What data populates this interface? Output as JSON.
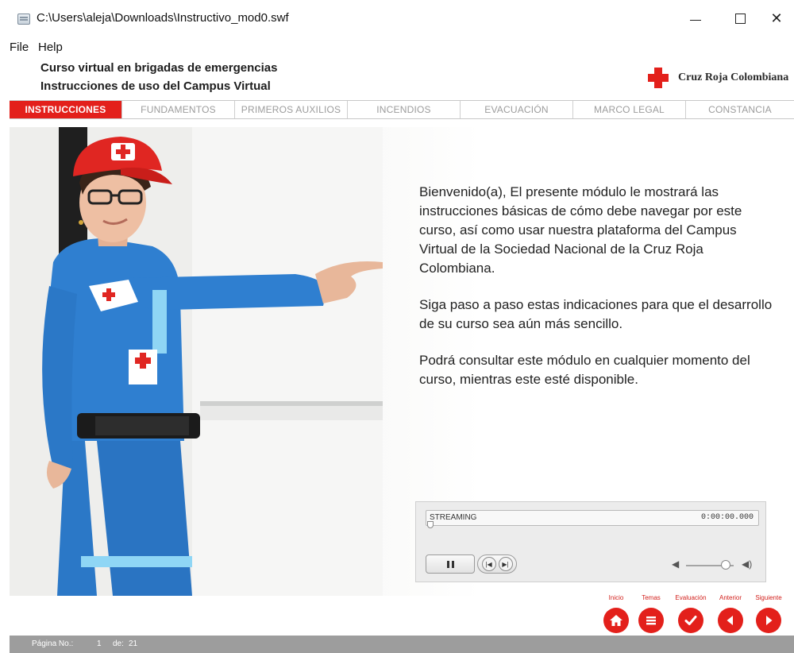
{
  "window": {
    "title": "C:\\Users\\aleja\\Downloads\\Instructivo_mod0.swf",
    "minimize_glyph": "—",
    "maximize_glyph": "☐",
    "close_glyph": "✕"
  },
  "menu": {
    "file": "File",
    "help": "Help"
  },
  "course": {
    "title": "Curso virtual en brigadas de emergencias",
    "subtitle": "Instrucciones de uso del Campus Virtual",
    "brand_name": "Cruz Roja Colombiana",
    "brand_color": "#e3201b"
  },
  "tabs": [
    {
      "label": "INSTRUCCIONES",
      "active": true
    },
    {
      "label": "FUNDAMENTOS",
      "active": false
    },
    {
      "label": "PRIMEROS AUXILIOS",
      "active": false
    },
    {
      "label": "INCENDIOS",
      "active": false
    },
    {
      "label": "EVACUACIÓN",
      "active": false
    },
    {
      "label": "MARCO LEGAL",
      "active": false
    },
    {
      "label": "CONSTANCIA",
      "active": false
    }
  ],
  "content": {
    "paragraphs": [
      "Bienvenido(a), El presente módulo le mostrará las instrucciones básicas de cómo debe navegar por este curso, así como usar nuestra plataforma del Campus Virtual de la Sociedad Nacional de la Cruz Roja Colombiana.",
      "Siga paso a paso estas indicaciones para que el desarrollo de su curso sea aún más sencillo.",
      "Podrá consultar este módulo en cualquier momento del curso, mientras este esté disponible."
    ]
  },
  "player": {
    "stream_label": "STREAMING",
    "time": "0:00:00.000",
    "progress": 0,
    "volume": 0.75,
    "icons": [
      "pause-icon",
      "skip-back-icon",
      "skip-forward-icon",
      "volume-low-icon",
      "volume-high-icon"
    ]
  },
  "nav": {
    "inicio": "Inicio",
    "temas": "Temas",
    "evaluacion": "Evaluación",
    "anterior": "Anterior",
    "siguiente": "Siguiente",
    "icons": [
      "home-icon",
      "menu-icon",
      "check-icon",
      "arrow-left-icon",
      "arrow-right-icon"
    ]
  },
  "status": {
    "page_label": "Página No.:",
    "page_number": "1",
    "of_label": "de:",
    "total_pages": "21"
  }
}
